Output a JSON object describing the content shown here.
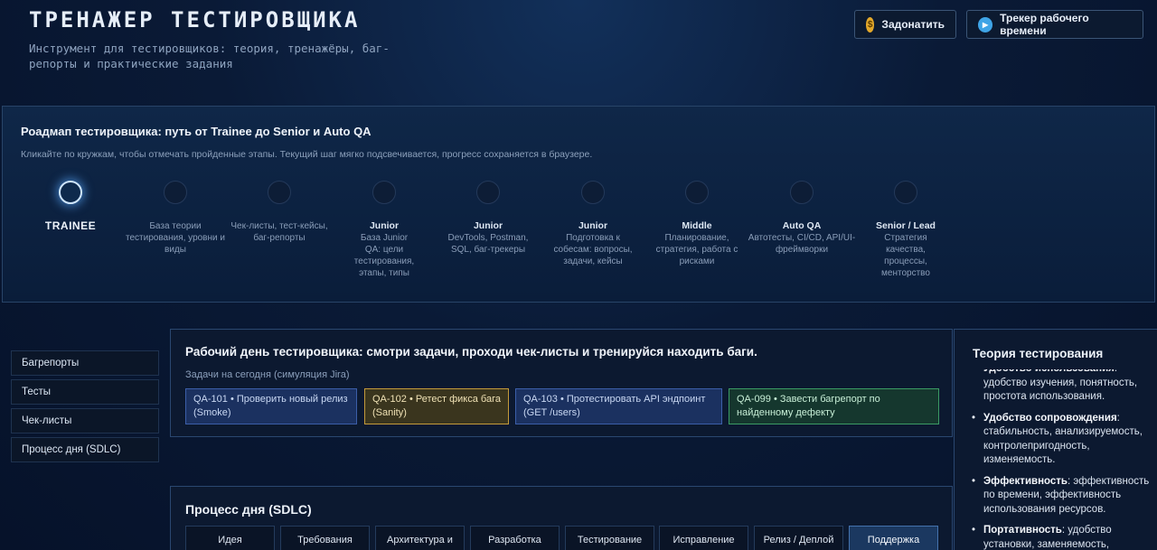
{
  "header": {
    "title": "ТРЕНАЖЕР ТЕСТИРОВЩИКА",
    "subtitle": "Инструмент для тестировщиков: теория, тренажёры, баг-репорты и практические задания",
    "donate_icon": "$",
    "donate_label": "Задонатить",
    "tracker_label": "Трекер рабочего времени"
  },
  "roadmap": {
    "title": "Роадмап тестировщика: путь от Trainee до Senior и Auto QA",
    "hint": "Кликайте по кружкам, чтобы отмечать пройденные этапы. Текущий шаг мягко подсвечивается, прогресс сохраняется в браузере.",
    "steps": [
      {
        "name": "TRAINEE",
        "desc": ""
      },
      {
        "name": "",
        "desc": "База теории тестирования, уровни и виды"
      },
      {
        "name": "",
        "desc": "Чек-листы, тест-кейсы, баг-репорты"
      },
      {
        "name": "Junior",
        "desc": "База Junior QA: цели тестирования, этапы, типы"
      },
      {
        "name": "Junior",
        "desc": "DevTools, Postman, SQL, баг-трекеры"
      },
      {
        "name": "Junior",
        "desc": "Подготовка к собесам: вопросы, задачи, кейсы"
      },
      {
        "name": "Middle",
        "desc": "Планирование, стратегия, работа с рисками"
      },
      {
        "name": "Auto QA",
        "desc": "Автотесты, CI/CD, API/UI-фреймворки"
      },
      {
        "name": "Senior / Lead",
        "desc": "Стратегия качества, процессы, менторство"
      }
    ]
  },
  "sidebar": {
    "items": [
      {
        "label": "Багрепорты"
      },
      {
        "label": "Тесты"
      },
      {
        "label": "Чек-листы"
      },
      {
        "label": "Процесс дня (SDLC)"
      }
    ]
  },
  "main": {
    "heading": "Рабочий день тестировщика: смотри задачи, проходи чек-листы и тренируйся находить баги.",
    "tasks_label": "Задачи на сегодня (симуляция Jira)",
    "tasks": [
      {
        "text": "QA-101 • Проверить новый релиз (Smoke)"
      },
      {
        "text": "QA-102 • Ретест фикса бага (Sanity)"
      },
      {
        "text": "QA-103 • Протестировать API эндпоинт (GET /users)"
      },
      {
        "text": "QA-099 • Завести багрепорт по найденному дефекту"
      }
    ]
  },
  "sdlc": {
    "title": "Процесс дня (SDLC)",
    "tabs": [
      {
        "label": "Идея"
      },
      {
        "label": "Требования"
      },
      {
        "label": "Архитектура и"
      },
      {
        "label": "Разработка"
      },
      {
        "label": "Тестирование"
      },
      {
        "label": "Исправление"
      },
      {
        "label": "Релиз / Деплой"
      },
      {
        "label": "Поддержка"
      }
    ]
  },
  "theory": {
    "title": "Теория тестирования",
    "top_fragment_bold": "Удобство использования",
    "top_fragment_text": ": удобство изучения, понятность, простота использования.",
    "items": [
      {
        "term": "Удобство сопровождения",
        "text": ": стабильность, анализируемость, контролепригодность, изменяемость."
      },
      {
        "term": "Эффективность",
        "text": ": эффективность по времени, эффективность использования ресурсов."
      },
      {
        "term": "Портативность",
        "text": ": удобство установки, заменяемость,"
      }
    ]
  }
}
